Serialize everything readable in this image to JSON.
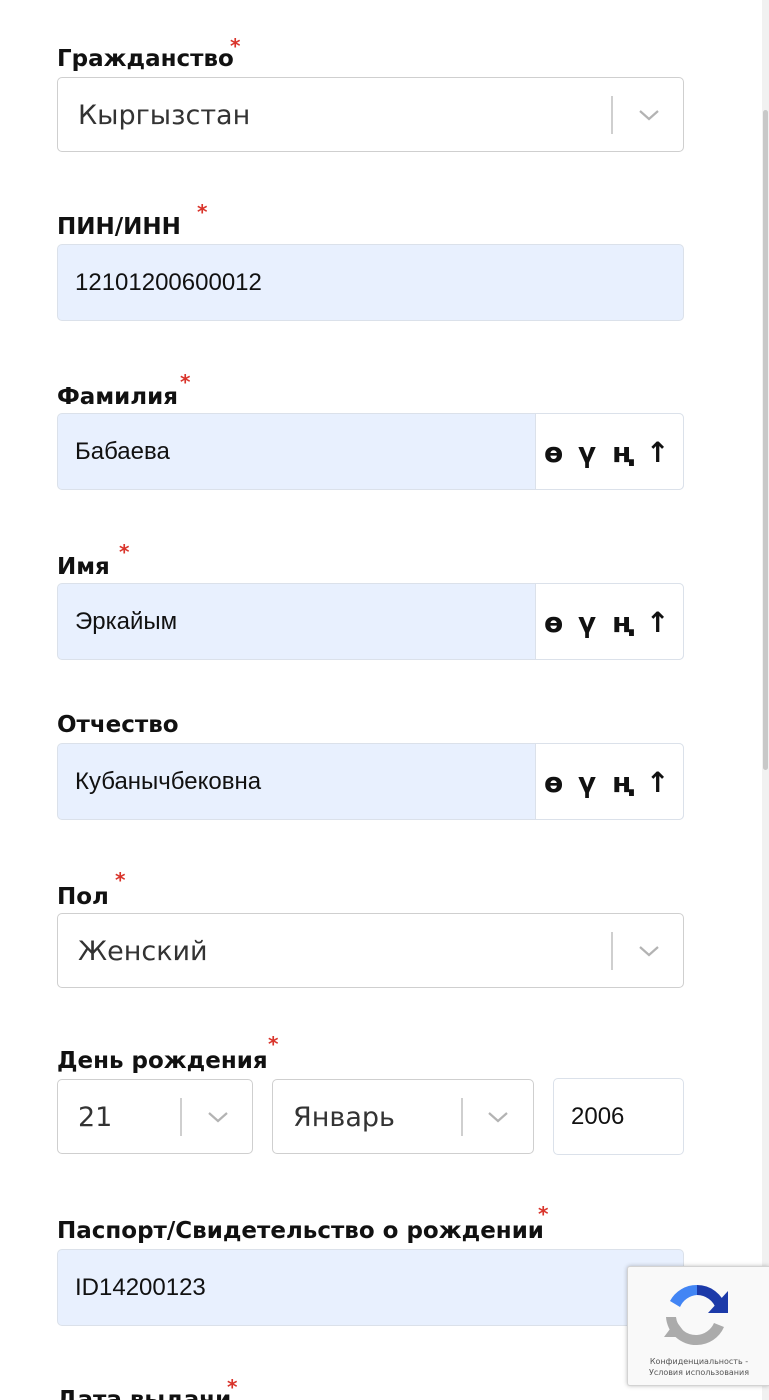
{
  "required_mark": "*",
  "citizenship": {
    "label": "Гражданство",
    "value": "Кыргызстан"
  },
  "pin": {
    "label": "ПИН/ИНН",
    "value": "12101200600012"
  },
  "surname": {
    "label": "Фамилия",
    "value": "Бабаева"
  },
  "first_name": {
    "label": "Имя",
    "value": "Эркайым"
  },
  "patronymic": {
    "label": "Отчество",
    "value": "Кубанычбековна"
  },
  "keyboard": {
    "o": "ө",
    "u": "ү",
    "n": "ң",
    "shift": "↑"
  },
  "gender": {
    "label": "Пол",
    "value": "Женский"
  },
  "birthday": {
    "label": "День рождения",
    "day": "21",
    "month": "Январь",
    "year": "2006"
  },
  "passport": {
    "label": "Паспорт/Свидетельство о рождении",
    "value": "ID14200123"
  },
  "issue_date": {
    "label": "Дата выдачи"
  },
  "recaptcha": {
    "privacy": "Конфиденциальность",
    "separator": "-",
    "terms": "Условия использования",
    "logo_icon": "recaptcha-logo-icon"
  },
  "colors": {
    "required": "#d9342b",
    "autofill_bg": "#e8f0fe",
    "border": "#cfcfcf",
    "recaptcha_blue": "#1c3aa9",
    "recaptcha_light_blue": "#4285f4",
    "recaptcha_gray": "#ababab"
  }
}
